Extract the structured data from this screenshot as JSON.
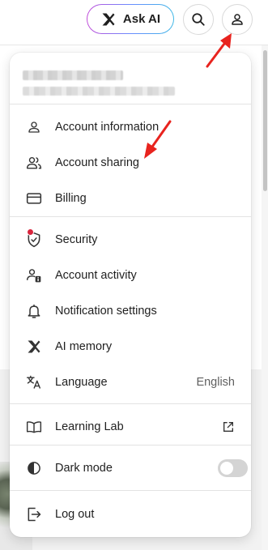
{
  "header": {
    "ask_ai_label": "Ask AI"
  },
  "menu": {
    "items": [
      {
        "label": "Account information",
        "icon": "person-icon"
      },
      {
        "label": "Account sharing",
        "icon": "people-icon"
      },
      {
        "label": "Billing",
        "icon": "credit-card-icon"
      },
      {
        "label": "Security",
        "icon": "shield-icon"
      },
      {
        "label": "Account activity",
        "icon": "person-info-icon"
      },
      {
        "label": "Notification settings",
        "icon": "bell-icon"
      },
      {
        "label": "AI memory",
        "icon": "ai-spark-icon"
      },
      {
        "label": "Language",
        "icon": "translate-icon",
        "value": "English"
      },
      {
        "label": "Learning Lab",
        "icon": "book-icon"
      },
      {
        "label": "Dark mode",
        "icon": "contrast-icon",
        "toggle_on": false
      },
      {
        "label": "Log out",
        "icon": "logout-icon"
      }
    ]
  },
  "colors": {
    "annotation_arrow": "#e8231e",
    "security_alert_dot": "#d9243c"
  }
}
